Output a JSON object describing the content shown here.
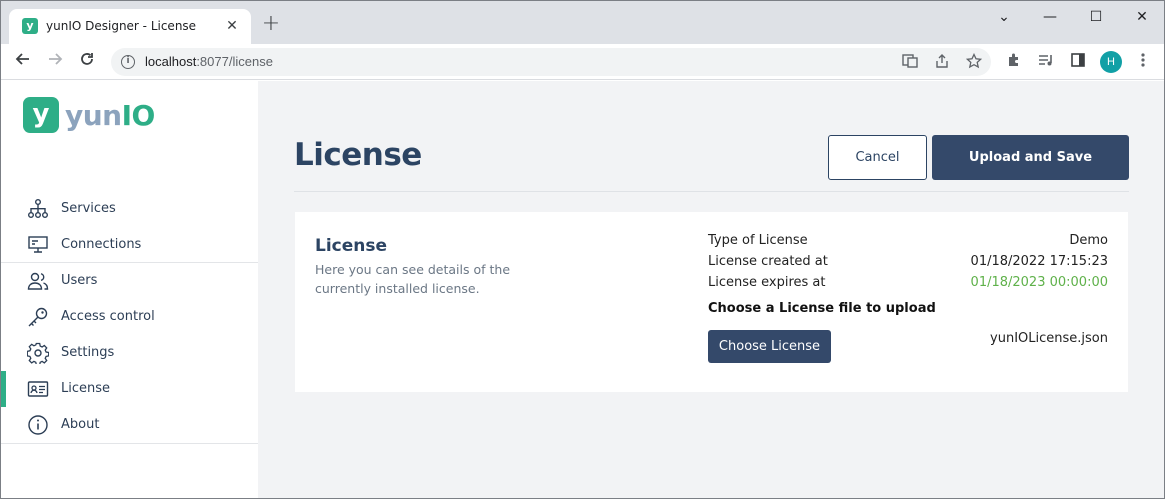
{
  "browser": {
    "tab_title": "yunIO Designer - License",
    "tab_close": "✕",
    "new_tab": "+",
    "url_host": "localhost",
    "url_rest": ":8077/license",
    "window": {
      "minimize": "⌄",
      "restore": "—",
      "maximize": "☐",
      "close": "✕"
    }
  },
  "logo": {
    "mark": "y",
    "text_a": "yun",
    "text_b": "IO"
  },
  "sidebar": {
    "items": [
      {
        "label": "Services",
        "icon": "hierarchy-icon"
      },
      {
        "label": "Connections",
        "icon": "monitor-icon"
      },
      {
        "label": "Users",
        "icon": "users-icon"
      },
      {
        "label": "Access control",
        "icon": "key-icon"
      },
      {
        "label": "Settings",
        "icon": "gear-icon"
      },
      {
        "label": "License",
        "icon": "id-card-icon",
        "active": true
      },
      {
        "label": "About",
        "icon": "info-icon"
      }
    ]
  },
  "page": {
    "title": "License",
    "cancel_label": "Cancel",
    "upload_label": "Upload and Save"
  },
  "card": {
    "title": "License",
    "description": "Here you can see details of the currently installed license.",
    "rows": [
      {
        "label": "Type of License",
        "value": "Demo"
      },
      {
        "label": "License created at",
        "value": "01/18/2022 17:15:23"
      },
      {
        "label": "License expires at",
        "value": "01/18/2023 00:00:00"
      }
    ],
    "choose_heading": "Choose a License file to upload",
    "choose_button": "Choose License",
    "filename": "yunIOLicense.json"
  },
  "colors": {
    "accent": "#2eae87",
    "primary": "#34496a",
    "expiry": "#5fb14a"
  },
  "profile_initial": "H"
}
